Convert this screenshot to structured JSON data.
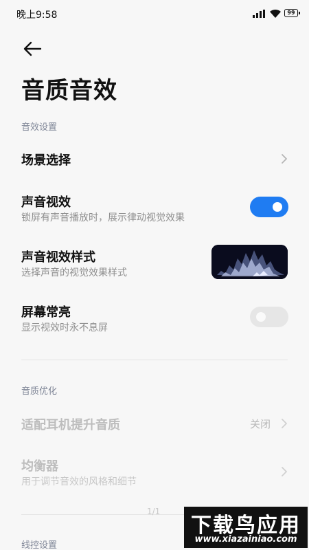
{
  "status_bar": {
    "time": "晚上9:58",
    "battery": "99",
    "icons": [
      "signal-icon",
      "wifi-icon",
      "battery-icon"
    ]
  },
  "header": {
    "back_icon": "arrow-left-icon",
    "title": "音质音效"
  },
  "sections": {
    "sound_effects": "音效设置",
    "sound_quality": "音质优化",
    "wire_control": "线控设置"
  },
  "settings": {
    "scene": {
      "title": "场景选择"
    },
    "visual_effect": {
      "title": "声音视效",
      "subtitle": "锁屏有声音播放时，展示律动视觉效果",
      "enabled": true
    },
    "visual_style": {
      "title": "声音视效样式",
      "subtitle": "选择声音的视觉效果样式"
    },
    "screen_on": {
      "title": "屏幕常亮",
      "subtitle": "显示视效时永不息屏",
      "enabled": false
    },
    "headphone": {
      "title": "适配耳机提升音质",
      "value": "关闭"
    },
    "equalizer": {
      "title": "均衡器",
      "subtitle": "用于调节音效的风格和细节"
    }
  },
  "page_indicator": "1/1",
  "watermark": {
    "main": "下载鸟应用",
    "sub": "www.xiazainiao.com"
  },
  "colors": {
    "accent": "#1f7cf2",
    "background": "#f7f7f7"
  }
}
